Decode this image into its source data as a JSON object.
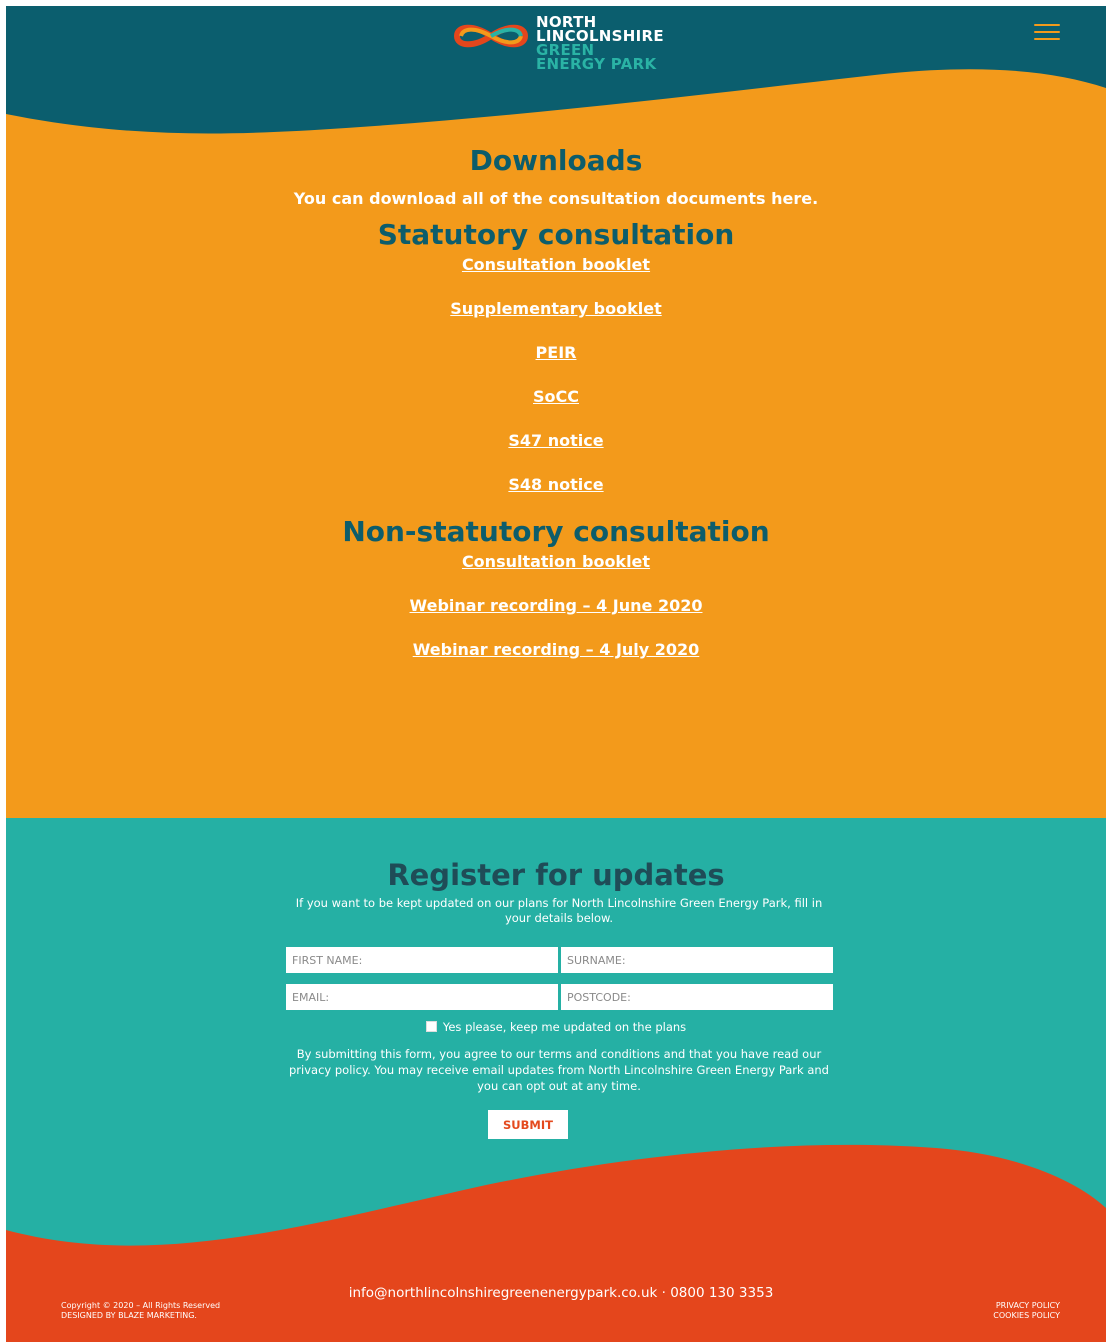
{
  "header": {
    "logo": {
      "line1": "NORTH",
      "line2": "LINCOLNSHIRE",
      "line3": "GREEN",
      "line4": "ENERGY PARK"
    },
    "menu_icon": "hamburger-menu-icon"
  },
  "downloads": {
    "title": "Downloads",
    "intro": "You can download all of the consultation documents here.",
    "sections": [
      {
        "heading": "Statutory consultation",
        "links": [
          "Consultation booklet",
          "Supplementary booklet",
          "PEIR",
          "SoCC",
          "S47 notice",
          "S48 notice"
        ]
      },
      {
        "heading": "Non-statutory consultation",
        "links": [
          "Consultation booklet",
          "Webinar recording – 4 June 2020",
          "Webinar recording – 4 July 2020"
        ]
      }
    ]
  },
  "register": {
    "title": "Register for updates",
    "description": "If you want to be kept updated on our plans for North Lincolnshire Green Energy Park, fill in your details below.",
    "fields": {
      "first_name": "FIRST NAME:",
      "surname": "SURNAME:",
      "email": "EMAIL:",
      "postcode": "POSTCODE:"
    },
    "optin_label": "Yes please, keep me updated on the plans",
    "terms": "By submitting this form, you agree to our terms and conditions and that you have read our privacy policy. You may receive email updates from North Lincolnshire Green Energy Park and you can opt out at any time.",
    "submit_label": "SUBMIT"
  },
  "footer": {
    "contact": "info@northlincolnshiregreenenergypark.co.uk · 0800 130 3353",
    "copyright": "Copyright © 2020 – All Rights Reserved",
    "designed_by": "DESIGNED BY BLAZE MARKETING.",
    "privacy_policy": "PRIVACY POLICY",
    "cookies_policy": "COOKIES POLICY"
  },
  "colors": {
    "header_bg": "#0b5e6e",
    "orange": "#f39a1b",
    "teal": "#25b0a4",
    "footer_red": "#e4461c",
    "heading_dark_teal": "#0d5d6b"
  }
}
